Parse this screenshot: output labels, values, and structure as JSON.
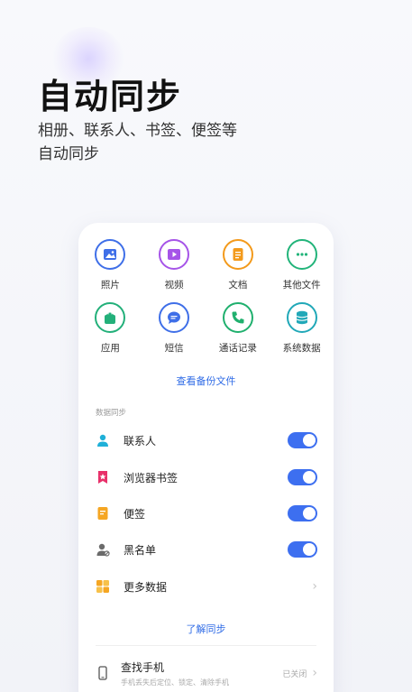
{
  "hero": {
    "title": "自动同步",
    "subtitle_line1": "相册、联系人、书签、便签等",
    "subtitle_line2": "自动同步"
  },
  "categories": [
    {
      "label": "照片",
      "icon": "photo-icon",
      "color": "#3f6fe8"
    },
    {
      "label": "视频",
      "icon": "video-icon",
      "color": "#a654e8"
    },
    {
      "label": "文档",
      "icon": "document-icon",
      "color": "#f39a1b"
    },
    {
      "label": "其他文件",
      "icon": "more-files-icon",
      "color": "#22b47a"
    },
    {
      "label": "应用",
      "icon": "app-icon",
      "color": "#23b07a"
    },
    {
      "label": "短信",
      "icon": "message-icon",
      "color": "#3f6fe8"
    },
    {
      "label": "通话记录",
      "icon": "phone-icon",
      "color": "#20b06e"
    },
    {
      "label": "系统数据",
      "icon": "database-icon",
      "color": "#21a8b8"
    }
  ],
  "view_backup_label": "查看备份文件",
  "sync_section": {
    "header": "数据同步",
    "items": [
      {
        "label": "联系人",
        "icon": "contact-icon",
        "toggle": "on"
      },
      {
        "label": "浏览器书签",
        "icon": "bookmark-icon",
        "toggle": "on"
      },
      {
        "label": "便签",
        "icon": "note-icon",
        "toggle": "on"
      },
      {
        "label": "黑名单",
        "icon": "blacklist-icon",
        "toggle": "on"
      }
    ],
    "more_label": "更多数据"
  },
  "learn_sync_label": "了解同步",
  "find_phone": {
    "title": "查找手机",
    "description": "手机丢失后定位、锁定、清除手机",
    "status": "已关闭"
  },
  "colors": {
    "accent": "#3d6ff0",
    "link": "#2f6be6"
  }
}
